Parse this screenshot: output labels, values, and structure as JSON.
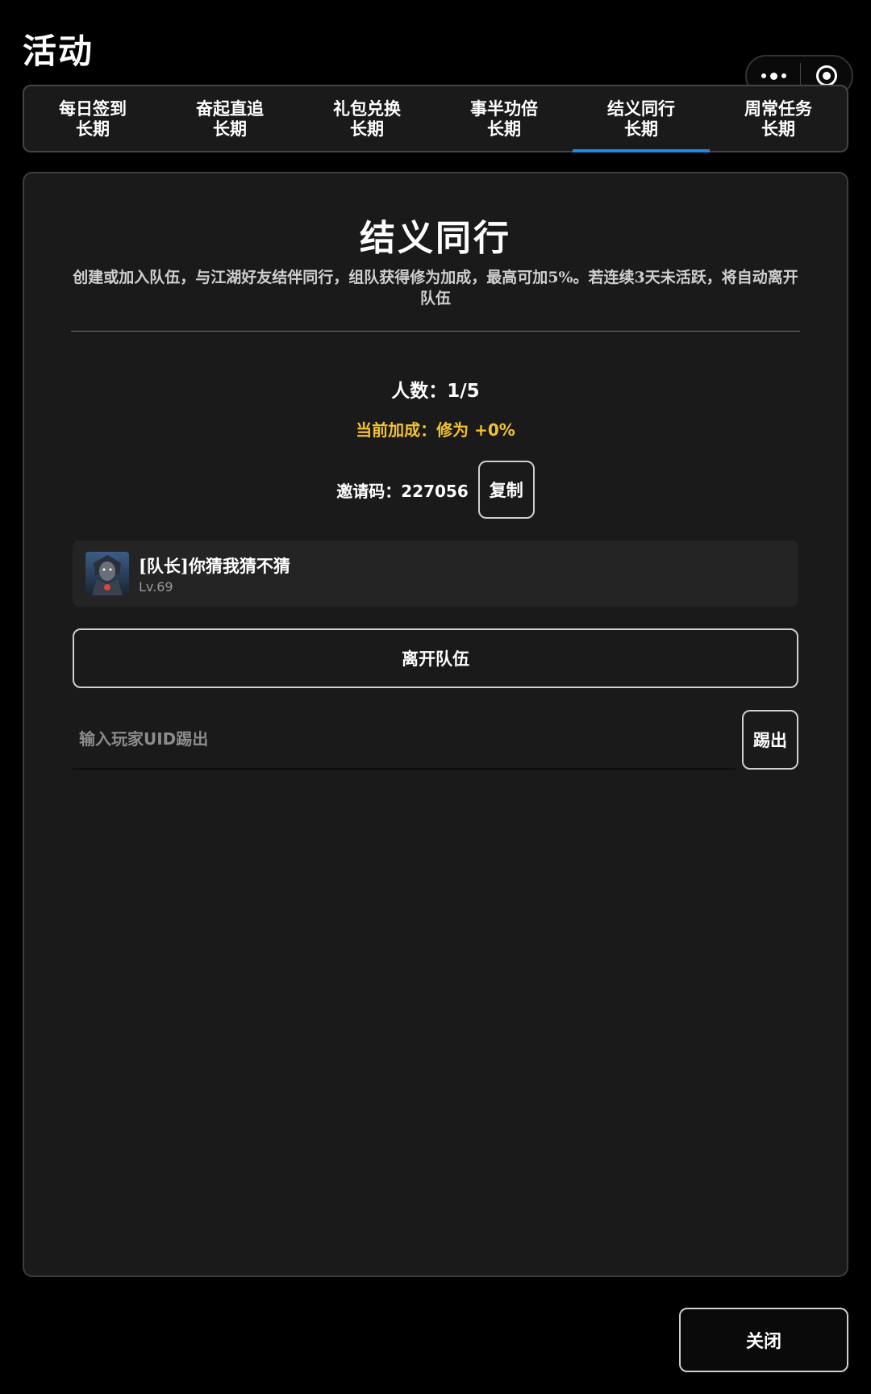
{
  "header": {
    "title": "活动"
  },
  "capsule": {
    "more_icon": "more-dots-icon",
    "close_icon": "target-icon"
  },
  "tabs": [
    {
      "name": "每日签到",
      "period": "长期",
      "active": false
    },
    {
      "name": "奋起直追",
      "period": "长期",
      "active": false
    },
    {
      "name": "礼包兑换",
      "period": "长期",
      "active": false
    },
    {
      "name": "事半功倍",
      "period": "长期",
      "active": false
    },
    {
      "name": "结义同行",
      "period": "长期",
      "active": true
    },
    {
      "name": "周常任务",
      "period": "长期",
      "active": false
    }
  ],
  "panel": {
    "title": "结义同行",
    "description": "创建或加入队伍，与江湖好友结伴同行，组队获得修为加成，最高可加5%。若连续3天未活跃，将自动离开队伍",
    "member_count": "人数：1/5",
    "bonus": "当前加成：修为 +0%",
    "invite": {
      "text": "邀请码：227056",
      "copy_label": "复制"
    },
    "members": [
      {
        "name": "[队长]你猜我猜不猜",
        "level": "Lv.69"
      }
    ],
    "leave_label": "离开队伍",
    "kick": {
      "placeholder": "输入玩家UID踢出",
      "button_label": "踢出"
    }
  },
  "footer": {
    "close_label": "关闭"
  },
  "colors": {
    "accent_tab_underline": "#1e88e5",
    "bonus_text": "#f2c230"
  }
}
